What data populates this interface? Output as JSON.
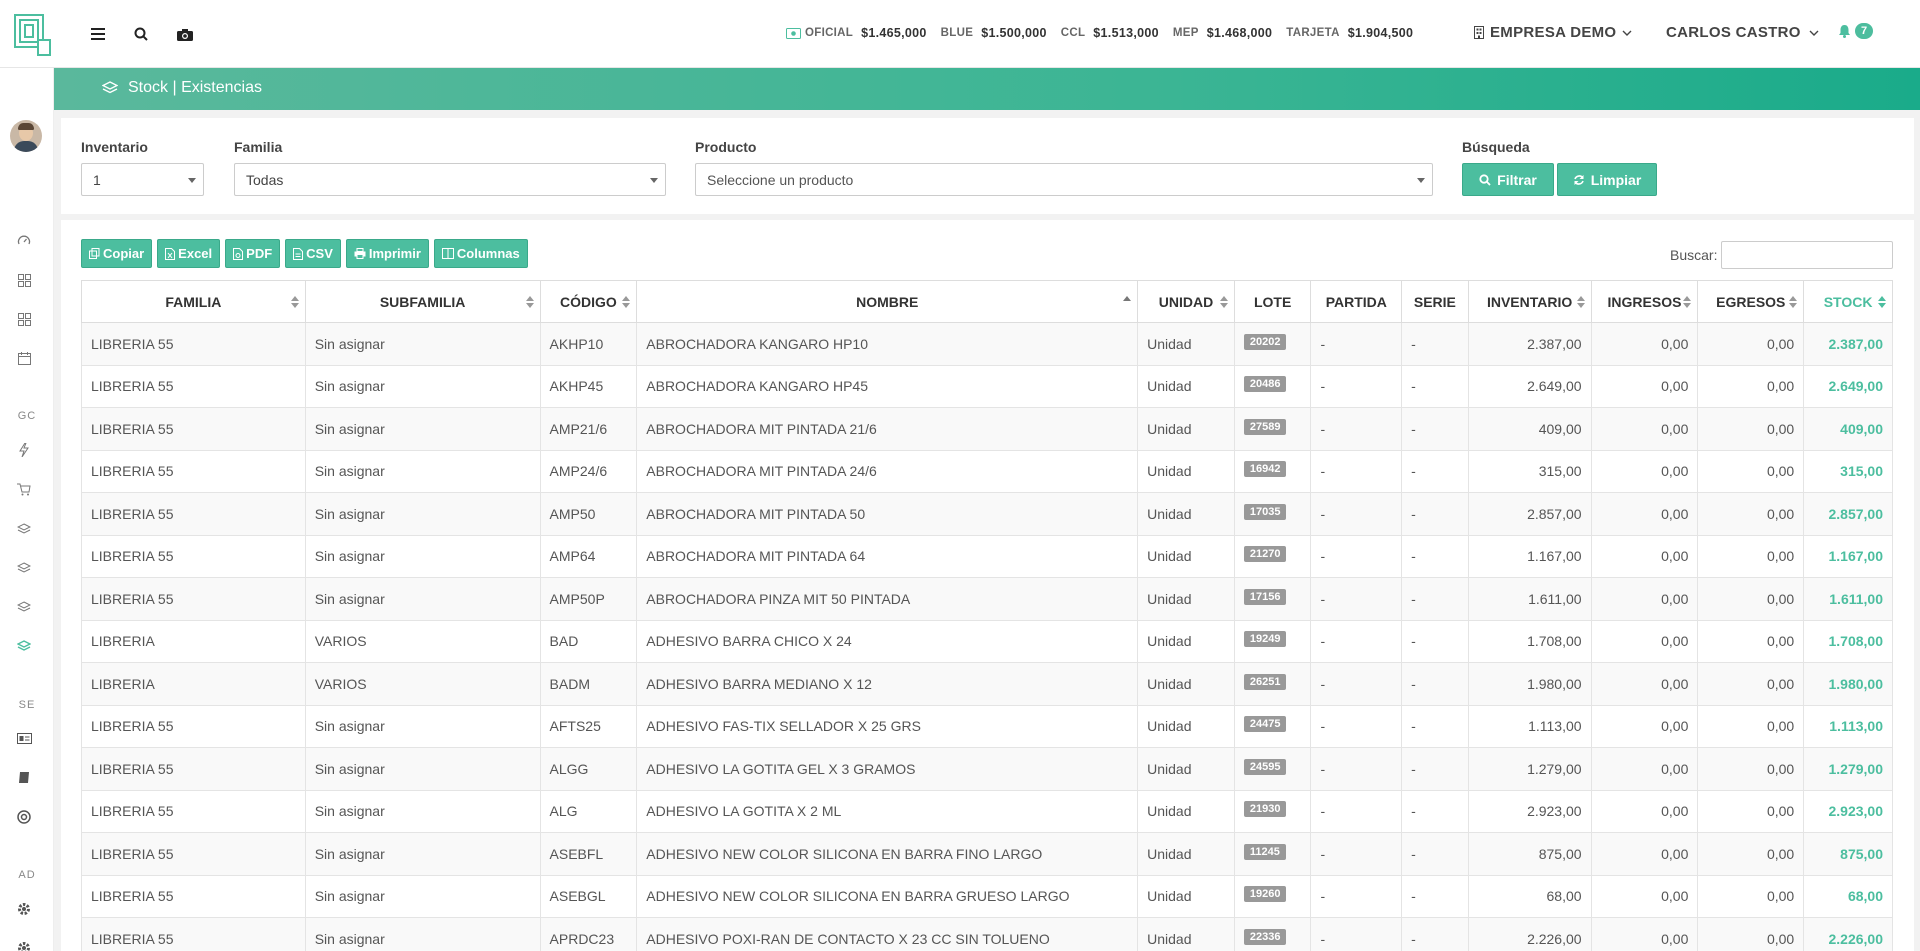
{
  "topbar": {
    "rates": [
      {
        "name": "OFICIAL",
        "value": "$1.465,000",
        "icon": "money-icon"
      },
      {
        "name": "BLUE",
        "value": "$1.500,000"
      },
      {
        "name": "CCL",
        "value": "$1.513,000"
      },
      {
        "name": "MEP",
        "value": "$1.468,000"
      },
      {
        "name": "TARJETA",
        "value": "$1.904,500"
      }
    ],
    "company": "EMPRESA DEMO",
    "user": "CARLOS CASTRO",
    "notifications": "7"
  },
  "sidebar": {
    "sections": [
      "GC",
      "SE",
      "AD"
    ]
  },
  "header": {
    "title": "Stock | Existencias"
  },
  "filters": {
    "inventario_label": "Inventario",
    "inventario_value": "1",
    "familia_label": "Familia",
    "familia_value": "Todas",
    "producto_label": "Producto",
    "producto_placeholder": "Seleccione un producto",
    "busqueda_label": "Búsqueda",
    "filtrar": "Filtrar",
    "limpiar": "Limpiar"
  },
  "toolbar": {
    "copiar": "Copiar",
    "excel": "Excel",
    "pdf": "PDF",
    "csv": "CSV",
    "imprimir": "Imprimir",
    "columnas": "Columnas",
    "search_label": "Buscar:"
  },
  "table": {
    "columns": [
      "FAMILIA",
      "SUBFAMILIA",
      "CÓDIGO",
      "NOMBRE",
      "UNIDAD",
      "LOTE",
      "PARTIDA",
      "SERIE",
      "INVENTARIO",
      "INGRESOS",
      "EGRESOS",
      "STOCK"
    ],
    "rows": [
      [
        "LIBRERIA 55",
        "Sin asignar",
        "AKHP10",
        "ABROCHADORA KANGARO HP10",
        "Unidad",
        "20202",
        "-",
        "-",
        "2.387,00",
        "0,00",
        "0,00",
        "2.387,00"
      ],
      [
        "LIBRERIA 55",
        "Sin asignar",
        "AKHP45",
        "ABROCHADORA KANGARO HP45",
        "Unidad",
        "20486",
        "-",
        "-",
        "2.649,00",
        "0,00",
        "0,00",
        "2.649,00"
      ],
      [
        "LIBRERIA 55",
        "Sin asignar",
        "AMP21/6",
        "ABROCHADORA MIT PINTADA 21/6",
        "Unidad",
        "27589",
        "-",
        "-",
        "409,00",
        "0,00",
        "0,00",
        "409,00"
      ],
      [
        "LIBRERIA 55",
        "Sin asignar",
        "AMP24/6",
        "ABROCHADORA MIT PINTADA 24/6",
        "Unidad",
        "16942",
        "-",
        "-",
        "315,00",
        "0,00",
        "0,00",
        "315,00"
      ],
      [
        "LIBRERIA 55",
        "Sin asignar",
        "AMP50",
        "ABROCHADORA MIT PINTADA 50",
        "Unidad",
        "17035",
        "-",
        "-",
        "2.857,00",
        "0,00",
        "0,00",
        "2.857,00"
      ],
      [
        "LIBRERIA 55",
        "Sin asignar",
        "AMP64",
        "ABROCHADORA MIT PINTADA 64",
        "Unidad",
        "21270",
        "-",
        "-",
        "1.167,00",
        "0,00",
        "0,00",
        "1.167,00"
      ],
      [
        "LIBRERIA 55",
        "Sin asignar",
        "AMP50P",
        "ABROCHADORA PINZA MIT 50 PINTADA",
        "Unidad",
        "17156",
        "-",
        "-",
        "1.611,00",
        "0,00",
        "0,00",
        "1.611,00"
      ],
      [
        "LIBRERIA",
        "VARIOS",
        "BAD",
        "ADHESIVO BARRA CHICO X 24",
        "Unidad",
        "19249",
        "-",
        "-",
        "1.708,00",
        "0,00",
        "0,00",
        "1.708,00"
      ],
      [
        "LIBRERIA",
        "VARIOS",
        "BADM",
        "ADHESIVO BARRA MEDIANO X 12",
        "Unidad",
        "26251",
        "-",
        "-",
        "1.980,00",
        "0,00",
        "0,00",
        "1.980,00"
      ],
      [
        "LIBRERIA 55",
        "Sin asignar",
        "AFTS25",
        "ADHESIVO FAS-TIX SELLADOR X 25 GRS",
        "Unidad",
        "24475",
        "-",
        "-",
        "1.113,00",
        "0,00",
        "0,00",
        "1.113,00"
      ],
      [
        "LIBRERIA 55",
        "Sin asignar",
        "ALGG",
        "ADHESIVO LA GOTITA GEL X 3 GRAMOS",
        "Unidad",
        "24595",
        "-",
        "-",
        "1.279,00",
        "0,00",
        "0,00",
        "1.279,00"
      ],
      [
        "LIBRERIA 55",
        "Sin asignar",
        "ALG",
        "ADHESIVO LA GOTITA X 2 ML",
        "Unidad",
        "21930",
        "-",
        "-",
        "2.923,00",
        "0,00",
        "0,00",
        "2.923,00"
      ],
      [
        "LIBRERIA 55",
        "Sin asignar",
        "ASEBFL",
        "ADHESIVO NEW COLOR SILICONA EN BARRA FINO LARGO",
        "Unidad",
        "11245",
        "-",
        "-",
        "875,00",
        "0,00",
        "0,00",
        "875,00"
      ],
      [
        "LIBRERIA 55",
        "Sin asignar",
        "ASEBGL",
        "ADHESIVO NEW COLOR SILICONA EN BARRA GRUESO LARGO",
        "Unidad",
        "19260",
        "-",
        "-",
        "68,00",
        "0,00",
        "0,00",
        "68,00"
      ],
      [
        "LIBRERIA 55",
        "Sin asignar",
        "APRDC23",
        "ADHESIVO POXI-RAN DE CONTACTO X 23 CC SIN TOLUENO",
        "Unidad",
        "22336",
        "-",
        "-",
        "2.226,00",
        "0,00",
        "0,00",
        "2.226,00"
      ]
    ]
  },
  "colors": {
    "accent": "#4cbe9f",
    "header_start": "#5ab89c",
    "header_end": "#1aab8a",
    "lote_badge": "#999999"
  }
}
